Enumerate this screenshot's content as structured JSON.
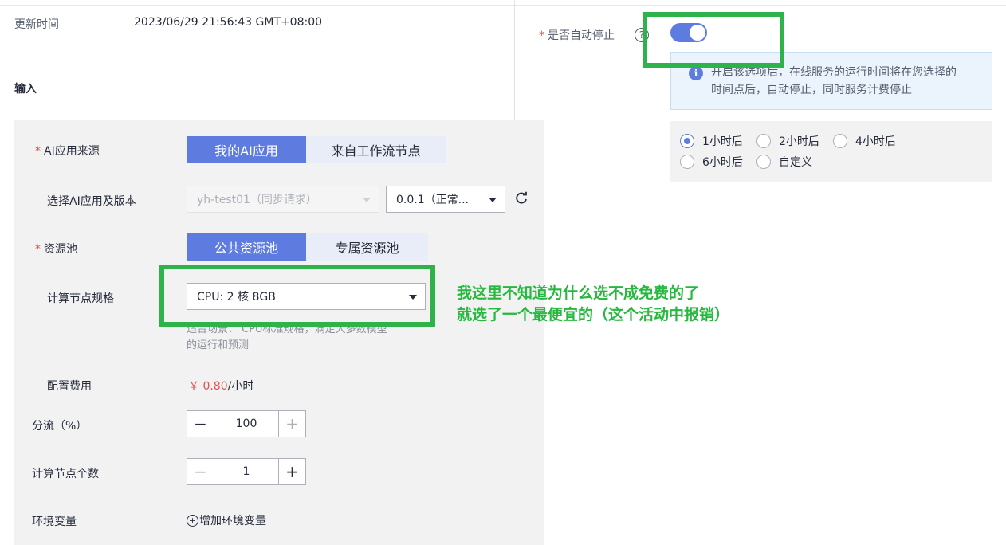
{
  "header": {
    "updated_label": "更新时间",
    "updated_value": "2023/06/29 21:56:43 GMT+08:00",
    "input_section": "输入"
  },
  "form": {
    "app_source": {
      "label": "AI应用来源",
      "required": "*",
      "options": [
        "我的AI应用",
        "来自工作流节点"
      ],
      "selected": "我的AI应用"
    },
    "app_version": {
      "label": "选择AI应用及版本",
      "app_value": "yh-test01（同步请求）",
      "version_value": "0.0.1（正常..."
    },
    "resource_pool": {
      "label": "资源池",
      "required": "*",
      "options": [
        "公共资源池",
        "专属资源池"
      ],
      "selected": "公共资源池"
    },
    "compute_spec": {
      "label": "计算节点规格",
      "value": "CPU: 2 核 8GB",
      "hint_line1": "适合场景： CPU标准规格，满足大多数模型",
      "hint_line2": "的运行和预测"
    },
    "cost": {
      "label": "配置费用",
      "price": "￥ 0.80",
      "unit": "/小时"
    },
    "traffic": {
      "label": "分流（%）",
      "value": "100"
    },
    "node_count": {
      "label": "计算节点个数",
      "value": "1"
    },
    "env": {
      "label": "环境变量",
      "add_label": "增加环境变量"
    }
  },
  "auto_stop": {
    "label": "是否自动停止",
    "required": "*",
    "enabled": true,
    "info_line1": "开启该选项后，在线服务的运行时间将在您选择的",
    "info_line2": "时间点后，自动停止，同时服务计费停止",
    "options": [
      "1小时后",
      "2小时后",
      "4小时后",
      "6小时后",
      "自定义"
    ],
    "selected": "1小时后"
  },
  "annotation": {
    "line1": "我这里不知道为什么选不成免费的了",
    "line2": "就选了一个最便宜的（这个活动中报销）"
  },
  "colors": {
    "primary": "#5e7ce0",
    "annotation_green": "#2eb24a",
    "price_red": "#e84e4e"
  }
}
